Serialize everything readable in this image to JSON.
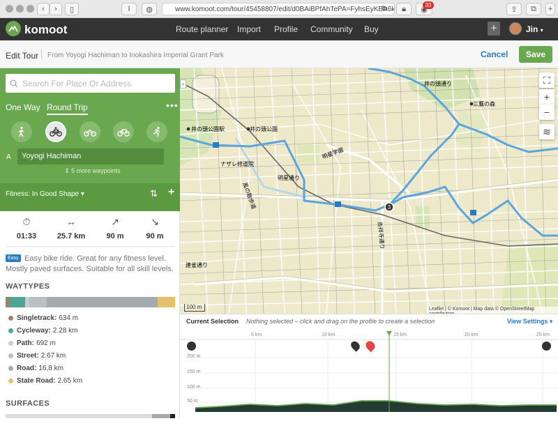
{
  "browser": {
    "url": "www.komoot.com/tour/45458807/edit/d0BAiBPfAhTePA=FyhsEyKBA6kw",
    "notification_count": "33"
  },
  "nav": {
    "brand": "komoot",
    "links": [
      "Route planner",
      "Import",
      "Profile",
      "Community",
      "Buy"
    ],
    "user": "Jin"
  },
  "editbar": {
    "title": "Edit Tour",
    "subtitle": "From Yoyogi Hachiman to Inokashira Imperial Grant Park",
    "cancel": "Cancel",
    "save": "Save"
  },
  "planner": {
    "search_placeholder": "Search For Place Or Address",
    "tab_one_way": "One Way",
    "tab_round_trip": "Round Trip",
    "sports": [
      "hiking-icon",
      "touring-bike-icon",
      "mountain-bike-icon",
      "road-bike-icon",
      "running-icon"
    ],
    "waypoint_letter": "A",
    "waypoint_value": "Yoyogi Hachiman",
    "more_waypoints": "5 more waypoints",
    "fitness": "Fitness: In Good Shape"
  },
  "stats": {
    "duration": "01:33",
    "distance": "25.7 km",
    "uphill": "90 m",
    "downhill": "90 m"
  },
  "description": {
    "tag": "Easy",
    "text": "Easy bike ride. Great for any fitness level. Mostly paved surfaces. Suitable for all skill levels."
  },
  "waytypes": {
    "title": "WAYTYPES",
    "items": [
      {
        "name": "Singletrack:",
        "value": "634 m",
        "color": "#a0816a",
        "weight": 2.5
      },
      {
        "name": "Cycleway:",
        "value": "2.28 km",
        "color": "#4ea597",
        "weight": 8.9
      },
      {
        "name": "Path:",
        "value": "692 m",
        "color": "#c8cdd0",
        "weight": 2.7
      },
      {
        "name": "Street:",
        "value": "2.67 km",
        "color": "#b9bfc3",
        "weight": 10.4
      },
      {
        "name": "Road:",
        "value": "16.8 km",
        "color": "#a3aab0",
        "weight": 65.4
      },
      {
        "name": "State Road:",
        "value": "2.65 km",
        "color": "#e8c06a",
        "weight": 10.3
      }
    ]
  },
  "surfaces": {
    "title": "SURFACES"
  },
  "map": {
    "scale_label": "100 m",
    "attribution": "Leaflet | © Komoot | Map data © OpenStreetMap contributors",
    "waypoint_marker": "3",
    "labels": [
      "井の頭公園駅",
      "井の頭公園",
      "三鷹の森",
      "ナザレ修道院",
      "明星通り",
      "連雀通り",
      "風の散歩道",
      "井の頭通り",
      "明星学園",
      "吉祥寺通り"
    ]
  },
  "elevation": {
    "current_selection": "Current Selection",
    "hint": "Nothing selected – click and drag on the profile to create a selection",
    "view_settings": "View Settings",
    "km_labels": [
      "5 km",
      "10 km",
      "15 km",
      "20 km",
      "25 km"
    ],
    "y_labels": [
      "200 m",
      "150 m",
      "100 m",
      "50 m"
    ]
  }
}
